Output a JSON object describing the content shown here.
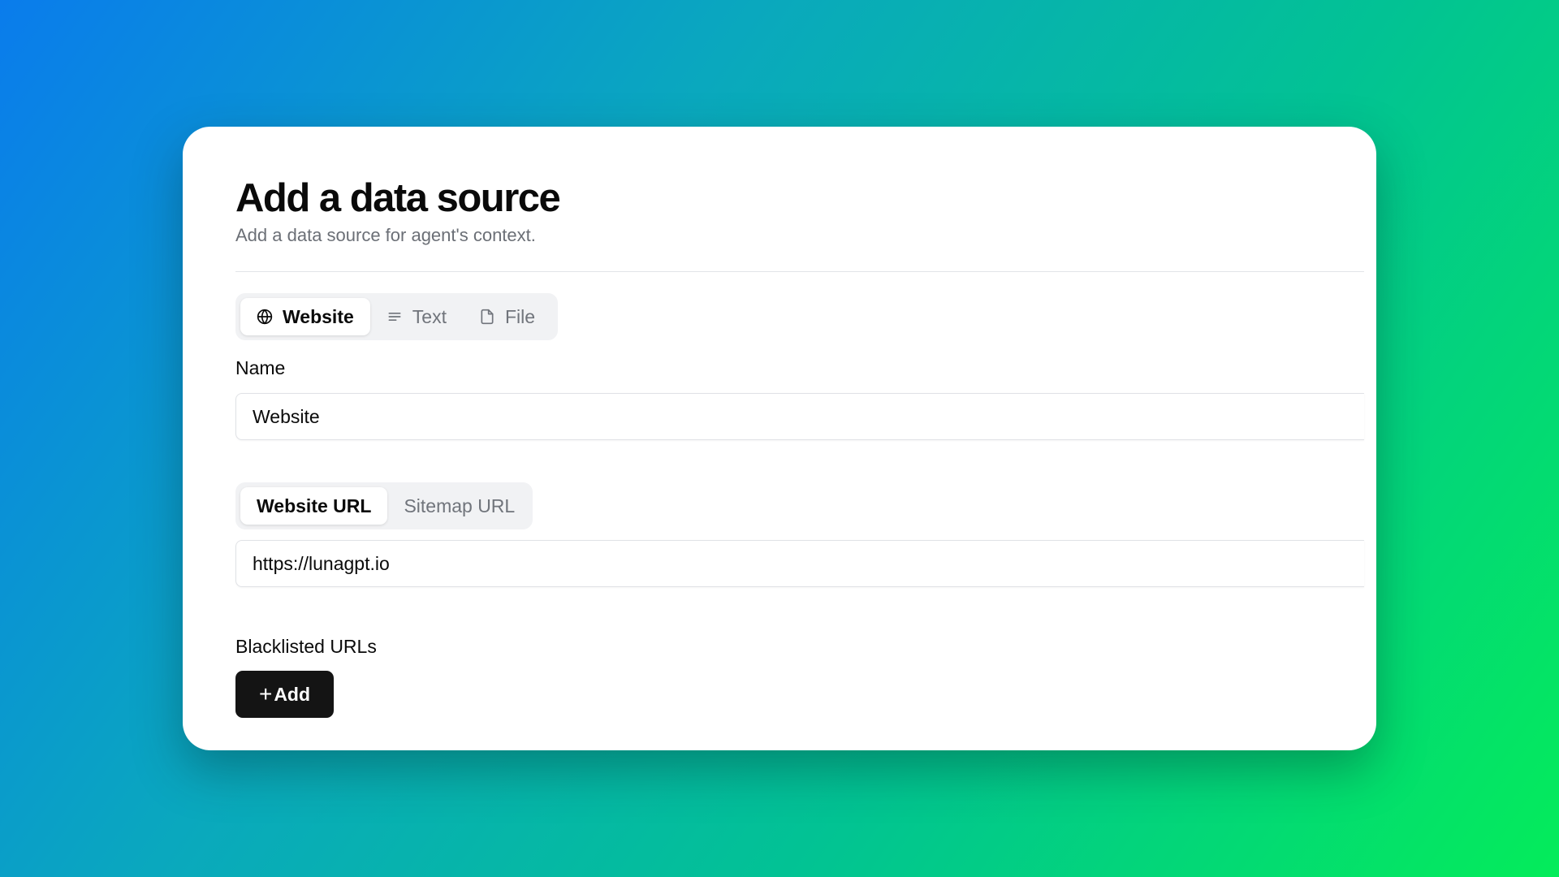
{
  "dialog": {
    "title": "Add a data source",
    "subtitle": "Add a data source for agent's context."
  },
  "source_tabs": [
    {
      "label": "Website",
      "icon": "globe-icon",
      "active": true
    },
    {
      "label": "Text",
      "icon": "text-lines-icon",
      "active": false
    },
    {
      "label": "File",
      "icon": "file-icon",
      "active": false
    }
  ],
  "name_field": {
    "label": "Name",
    "value": "Website"
  },
  "url_tabs": [
    {
      "label": "Website URL",
      "active": true
    },
    {
      "label": "Sitemap URL",
      "active": false
    }
  ],
  "url_field": {
    "value": "https://lunagpt.io"
  },
  "blacklist": {
    "label": "Blacklisted URLs",
    "add_icon": "+",
    "add_label": "Add"
  },
  "colors": {
    "button_bg": "#141414",
    "active_tab_bg": "#ffffff",
    "tabs_bg": "#f1f2f4"
  }
}
